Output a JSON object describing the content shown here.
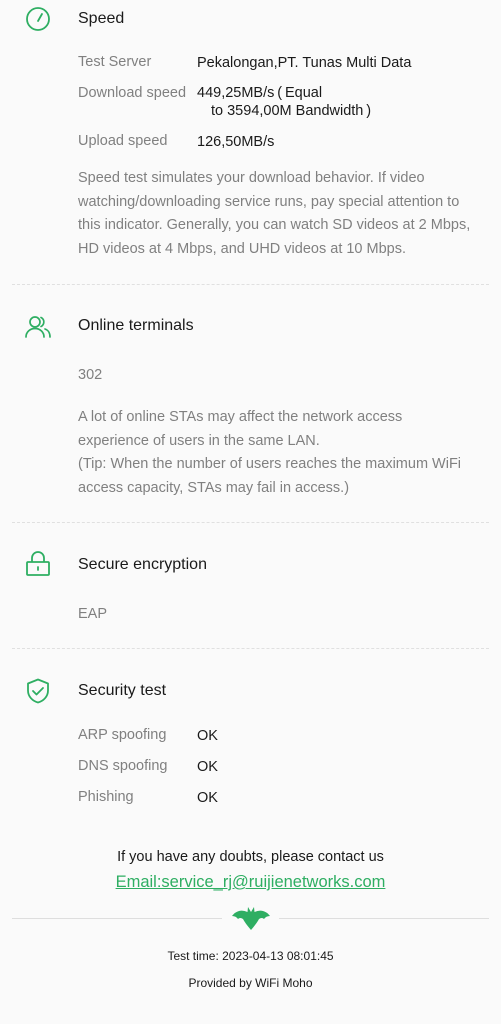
{
  "speed": {
    "title": "Speed",
    "icon": "speedometer-icon",
    "server_label": "Test Server",
    "server_value": "Pekalongan,PT. Tunas Multi Data",
    "download_label": "Download speed",
    "download_value_line1": "449,25MB/s ( Equal",
    "download_value_line2": "to 3594,00M Bandwidth )",
    "upload_label": "Upload speed",
    "upload_value": "126,50MB/s",
    "description": "Speed test simulates your download behavior. If video watching/downloading service runs, pay special attention to this indicator. Generally, you can watch SD videos at 2 Mbps, HD videos at 4 Mbps, and UHD videos at 10 Mbps."
  },
  "terminals": {
    "title": "Online terminals",
    "icon": "users-icon",
    "count": "302",
    "description_line1": "A lot of online STAs may affect the network access experience of users in the same LAN.",
    "description_line2": "(Tip: When the number of users reaches the maximum WiFi access capacity, STAs may fail in access.)"
  },
  "encryption": {
    "title": "Secure encryption",
    "icon": "lock-icon",
    "value": "EAP"
  },
  "security": {
    "title": "Security test",
    "icon": "shield-check-icon",
    "items": [
      {
        "label": "ARP spoofing",
        "value": "OK"
      },
      {
        "label": "DNS spoofing",
        "value": "OK"
      },
      {
        "label": "Phishing",
        "value": "OK"
      }
    ]
  },
  "contact": {
    "text": "If you have any doubts, please contact us",
    "email": "Email:service_rj@ruijienetworks.com"
  },
  "footer": {
    "logo": "bat-logo-icon",
    "test_time": "Test time: 2023-04-13 08:01:45",
    "provided_by": "Provided by WiFi Moho"
  },
  "colors": {
    "accent": "#2eae62",
    "label": "#808080",
    "text": "#1a1a1a",
    "background": "#fafafa"
  }
}
